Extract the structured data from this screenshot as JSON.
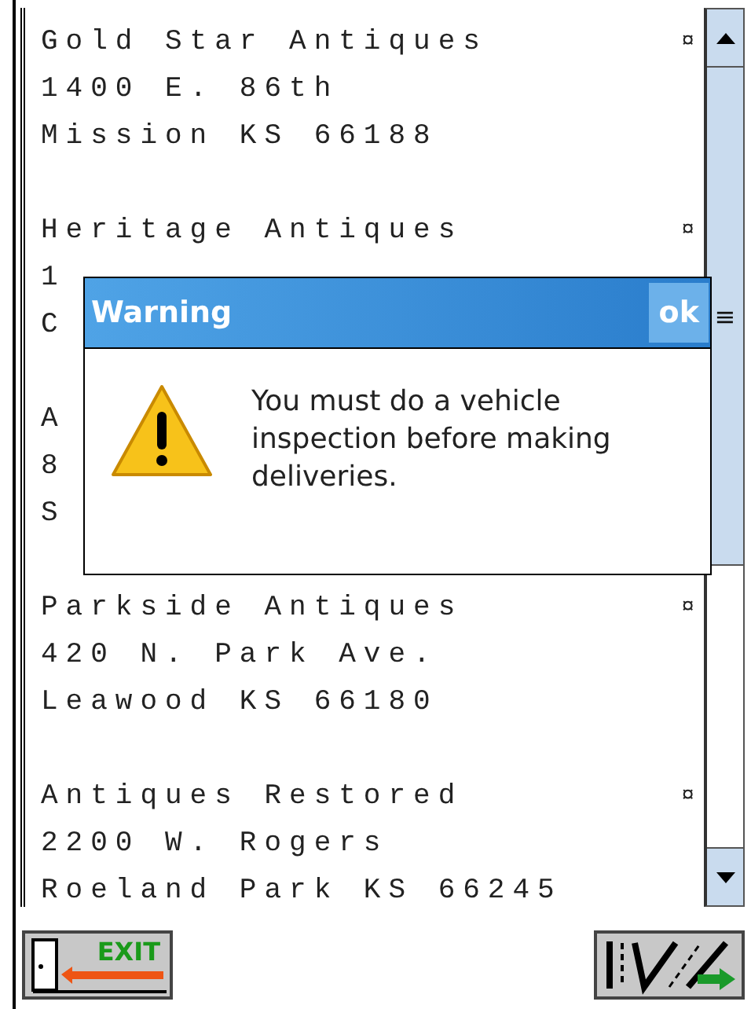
{
  "entries": [
    {
      "name": "Gold Star Antiques",
      "mark": "¤",
      "lines": [
        "1400 E. 86th",
        "Mission KS 66188"
      ]
    },
    {
      "name": "Heritage Antiques",
      "mark": "¤",
      "lines": [
        "1",
        "C"
      ]
    },
    {
      "name": "A",
      "lines": [
        "8",
        "S"
      ]
    },
    {
      "name": "Parkside Antiques",
      "mark": "¤",
      "lines": [
        "420 N. Park Ave.",
        "Leawood KS 66180"
      ]
    },
    {
      "name": "Antiques Restored",
      "mark": "¤",
      "lines": [
        "2200 W. Rogers",
        "Roeland Park KS 66245"
      ]
    }
  ],
  "dialog": {
    "title": "Warning",
    "button": "ok",
    "message": "You must do a vehicle inspection before making deliveries."
  },
  "scrollbar": {
    "grip": "≡"
  },
  "toolbar": {
    "exit_button": {
      "label": "EXIT"
    }
  }
}
